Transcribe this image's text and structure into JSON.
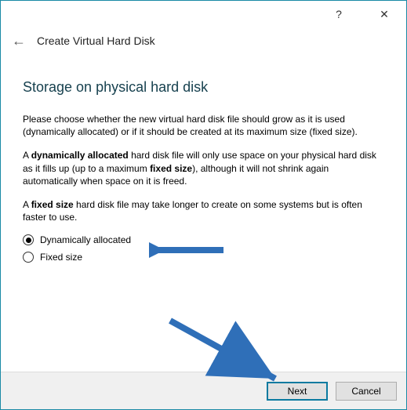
{
  "titlebar": {
    "help_symbol": "?",
    "close_symbol": "✕"
  },
  "header": {
    "back_symbol": "←",
    "title": "Create Virtual Hard Disk"
  },
  "section": {
    "heading": "Storage on physical hard disk",
    "intro": "Please choose whether the new virtual hard disk file should grow as it is used (dynamically allocated) or if it should be created at its maximum size (fixed size).",
    "dyn_prefix": "A ",
    "dyn_bold": "dynamically allocated",
    "dyn_mid": " hard disk file will only use space on your physical hard disk as it fills up (up to a maximum ",
    "dyn_bold2": "fixed size",
    "dyn_suffix": "), although it will not shrink again automatically when space on it is freed.",
    "fixed_prefix": "A ",
    "fixed_bold": "fixed size",
    "fixed_suffix": " hard disk file may take longer to create on some systems but is often faster to use."
  },
  "radios": {
    "dynamic": "Dynamically allocated",
    "fixed": "Fixed size",
    "selected": "dynamic"
  },
  "footer": {
    "next": "Next",
    "cancel": "Cancel"
  },
  "annotations": {
    "arrow_color": "#2f6fb8"
  }
}
